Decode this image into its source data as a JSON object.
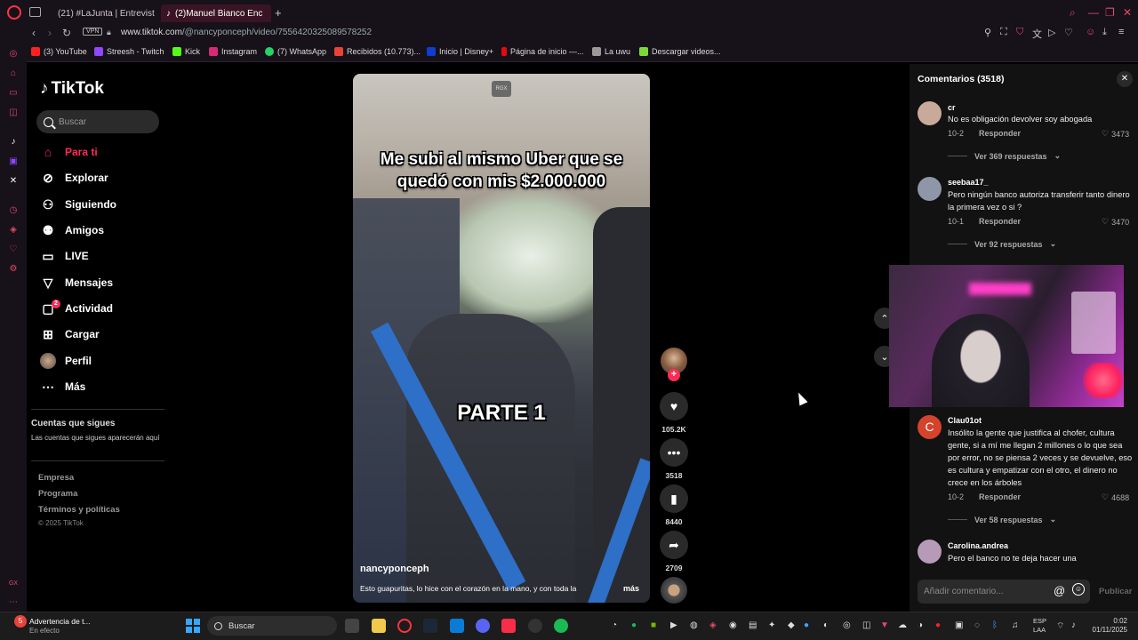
{
  "browser": {
    "tabs": [
      {
        "label": "(21) #LaJunta | Entrevista"
      },
      {
        "label": "(2)Manuel Bianco Enc"
      }
    ],
    "new_tab": "+",
    "url_domain": "www.tiktok.com",
    "url_path": "/@nancyponceph/video/7556420325089578252",
    "vpn": "VPN",
    "bookmarks": [
      {
        "label": "(3) YouTube",
        "color": "#ff2020"
      },
      {
        "label": "Streesh - Twitch",
        "color": "#9146ff"
      },
      {
        "label": "Kick",
        "color": "#53fc18"
      },
      {
        "label": "Instagram",
        "color": "#d62976"
      },
      {
        "label": "(7) WhatsApp",
        "color": "#25d366"
      },
      {
        "label": "Recibidos (10.773)...",
        "color": "#ea4335"
      },
      {
        "label": "Inicio | Disney+",
        "color": "#113ccf"
      },
      {
        "label": "Página de inicio —...",
        "color": "#e50914"
      },
      {
        "label": "La uwu",
        "color": "#999999"
      },
      {
        "label": "Descargar videos...",
        "color": "#7bd93a"
      }
    ]
  },
  "tiktok": {
    "logo": "TikTok",
    "search_placeholder": "Buscar",
    "nav": [
      {
        "label": "Para ti",
        "icon": "home-icon"
      },
      {
        "label": "Explorar",
        "icon": "compass-icon"
      },
      {
        "label": "Siguiendo",
        "icon": "following-icon"
      },
      {
        "label": "Amigos",
        "icon": "friends-icon"
      },
      {
        "label": "LIVE",
        "icon": "live-icon"
      },
      {
        "label": "Mensajes",
        "icon": "messages-icon"
      },
      {
        "label": "Actividad",
        "icon": "activity-icon",
        "badge": "2"
      },
      {
        "label": "Cargar",
        "icon": "upload-icon"
      },
      {
        "label": "Perfil",
        "icon": "profile-avatar"
      },
      {
        "label": "Más",
        "icon": "more-icon"
      }
    ],
    "following_title": "Cuentas que sigues",
    "following_desc": "Las cuentas que sigues aparecerán aquí",
    "footer": [
      "Empresa",
      "Programa",
      "Términos y políticas"
    ],
    "copyright": "© 2025 TikTok"
  },
  "video": {
    "watermark": "RGX",
    "caption": "Me subi al mismo Uber que se quedó con mis $2.000.000",
    "part": "PARTE 1",
    "username": "nancyponceph",
    "description": "Esto guapuritas, lo hice con el corazón en la mano, y con toda la",
    "more": "más",
    "likes": "105.2K",
    "comments": "3518",
    "saves": "8440",
    "shares": "2709"
  },
  "comments_panel": {
    "title": "Comentarios (3518)",
    "items": [
      {
        "user": "cr",
        "text": "No es obligación devolver soy abogada",
        "date": "10-2",
        "reply": "Responder",
        "likes": "3473",
        "view": "Ver 369 respuestas",
        "avatar_color": "#c9a99a"
      },
      {
        "user": "seebaa17_",
        "text": "Pero ningún banco autoriza transferir tanto dinero la primera vez o si ?",
        "date": "10-1",
        "reply": "Responder",
        "likes": "3470",
        "view": "Ver 92 respuestas",
        "avatar_color": "#8e96a8"
      },
      {
        "user": "Clau01ot",
        "text": "Insólito la gente que justifica al chofer, cultura gente, si a mí me llegan 2 millones o lo que sea por error, no se piensa 2 veces y se devuelve, eso es cultura y empatizar con el otro, el dinero no crece en los árboles",
        "date": "10-2",
        "reply": "Responder",
        "likes": "4688",
        "view": "Ver 58 respuestas",
        "avatar_color": "#d5432c",
        "avatar_letter": "C"
      },
      {
        "user": "Carolina.andrea",
        "text": "Pero el banco no te deja hacer una",
        "avatar_color": "#b69ab8"
      }
    ],
    "input_placeholder": "Añadir comentario...",
    "publish": "Publicar"
  },
  "taskbar": {
    "warning_badge": "5",
    "warning_title": "Advertencia de t...",
    "warning_sub": "En efecto",
    "search": "Buscar",
    "lang1": "ESP",
    "lang2": "LAA",
    "time": "0:02",
    "date": "01/11/2025"
  }
}
